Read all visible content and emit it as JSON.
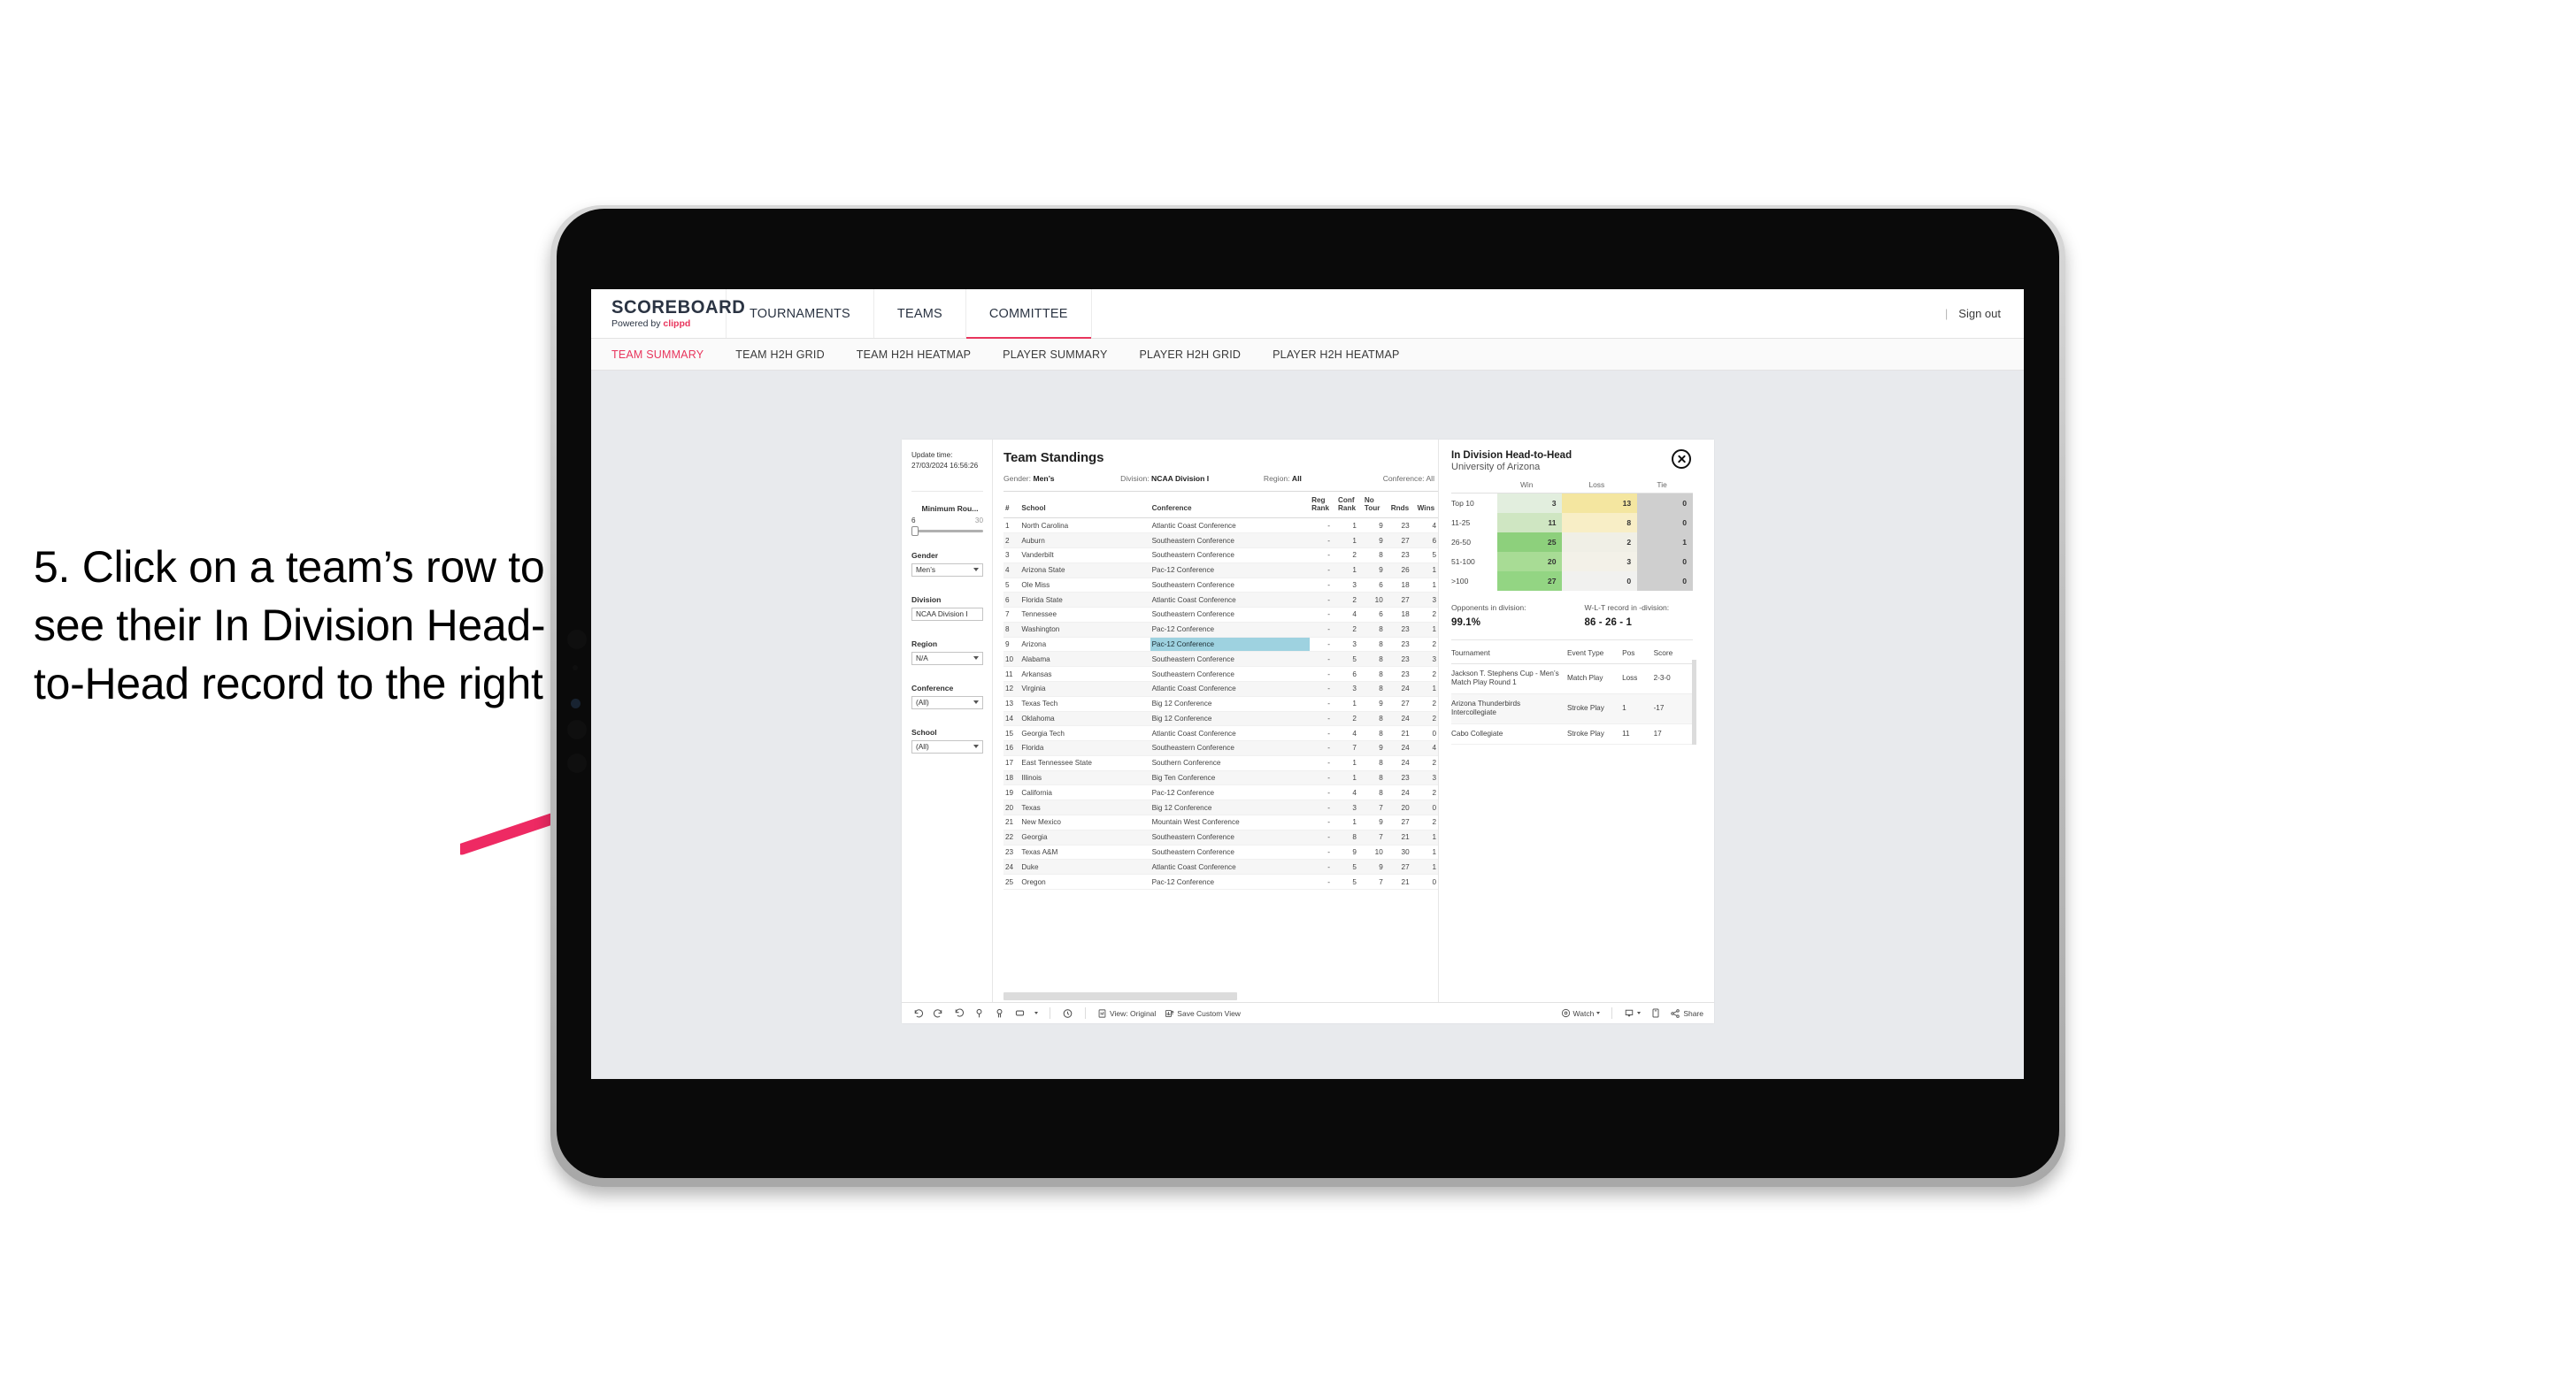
{
  "annotation": {
    "text": "5. Click on a team’s row to see their In Division Head-to-Head record to the right",
    "arrow_color": "#ee2a63"
  },
  "app": {
    "logo": {
      "main": "SCOREBOARD",
      "powered_prefix": "Powered by ",
      "powered_brand": "clippd"
    },
    "topnav": [
      {
        "label": "TOURNAMENTS",
        "active": false
      },
      {
        "label": "TEAMS",
        "active": false
      },
      {
        "label": "COMMITTEE",
        "active": true
      }
    ],
    "header_right": {
      "divider": "|",
      "sign_out": "Sign out"
    },
    "subnav": [
      {
        "label": "TEAM SUMMARY",
        "active": true
      },
      {
        "label": "TEAM H2H GRID",
        "active": false
      },
      {
        "label": "TEAM H2H HEATMAP",
        "active": false
      },
      {
        "label": "PLAYER SUMMARY",
        "active": false
      },
      {
        "label": "PLAYER H2H GRID",
        "active": false
      },
      {
        "label": "PLAYER H2H HEATMAP",
        "active": false
      }
    ]
  },
  "filters": {
    "update_time_label": "Update time:",
    "update_time_value": "27/03/2024 16:56:26",
    "min_rounds": {
      "title": "Minimum Rou...",
      "min": "6",
      "max": "30",
      "value": 6
    },
    "gender": {
      "title": "Gender",
      "value": "Men’s"
    },
    "division": {
      "title": "Division",
      "value": "NCAA Division I"
    },
    "region": {
      "title": "Region",
      "value": "N/A"
    },
    "conference": {
      "title": "Conference",
      "value": "(All)"
    },
    "school": {
      "title": "School",
      "value": "(All)"
    }
  },
  "standings": {
    "title": "Team Standings",
    "meta": {
      "gender_label": "Gender:",
      "gender_value": "Men’s",
      "division_label": "Division:",
      "division_value": "NCAA Division I",
      "region_label": "Region:",
      "region_value": "All",
      "conference_label": "Conference:",
      "conference_value": "All"
    },
    "columns": [
      "#",
      "School",
      "Conference",
      "Reg Rank",
      "Conf Rank",
      "No Tour",
      "Rnds",
      "Wins"
    ],
    "column_lines": [
      [
        "#",
        ""
      ],
      [
        "School",
        ""
      ],
      [
        "Conference",
        ""
      ],
      [
        "Reg",
        "Rank"
      ],
      [
        "Conf",
        "Rank"
      ],
      [
        "No",
        "Tour"
      ],
      [
        "Rnds",
        ""
      ],
      [
        "Wins",
        ""
      ]
    ],
    "selected_rank": 9,
    "rows": [
      {
        "rank": "1",
        "school": "North Carolina",
        "conference": "Atlantic Coast Conference",
        "reg_rank": "-",
        "conf_rank": "1",
        "no_tour": "9",
        "rnds": "23",
        "wins": "4"
      },
      {
        "rank": "2",
        "school": "Auburn",
        "conference": "Southeastern Conference",
        "reg_rank": "-",
        "conf_rank": "1",
        "no_tour": "9",
        "rnds": "27",
        "wins": "6"
      },
      {
        "rank": "3",
        "school": "Vanderbilt",
        "conference": "Southeastern Conference",
        "reg_rank": "-",
        "conf_rank": "2",
        "no_tour": "8",
        "rnds": "23",
        "wins": "5"
      },
      {
        "rank": "4",
        "school": "Arizona State",
        "conference": "Pac-12 Conference",
        "reg_rank": "-",
        "conf_rank": "1",
        "no_tour": "9",
        "rnds": "26",
        "wins": "1"
      },
      {
        "rank": "5",
        "school": "Ole Miss",
        "conference": "Southeastern Conference",
        "reg_rank": "-",
        "conf_rank": "3",
        "no_tour": "6",
        "rnds": "18",
        "wins": "1"
      },
      {
        "rank": "6",
        "school": "Florida State",
        "conference": "Atlantic Coast Conference",
        "reg_rank": "-",
        "conf_rank": "2",
        "no_tour": "10",
        "rnds": "27",
        "wins": "3"
      },
      {
        "rank": "7",
        "school": "Tennessee",
        "conference": "Southeastern Conference",
        "reg_rank": "-",
        "conf_rank": "4",
        "no_tour": "6",
        "rnds": "18",
        "wins": "2"
      },
      {
        "rank": "8",
        "school": "Washington",
        "conference": "Pac-12 Conference",
        "reg_rank": "-",
        "conf_rank": "2",
        "no_tour": "8",
        "rnds": "23",
        "wins": "1"
      },
      {
        "rank": "9",
        "school": "Arizona",
        "conference": "Pac-12 Conference",
        "reg_rank": "-",
        "conf_rank": "3",
        "no_tour": "8",
        "rnds": "23",
        "wins": "2"
      },
      {
        "rank": "10",
        "school": "Alabama",
        "conference": "Southeastern Conference",
        "reg_rank": "-",
        "conf_rank": "5",
        "no_tour": "8",
        "rnds": "23",
        "wins": "3"
      },
      {
        "rank": "11",
        "school": "Arkansas",
        "conference": "Southeastern Conference",
        "reg_rank": "-",
        "conf_rank": "6",
        "no_tour": "8",
        "rnds": "23",
        "wins": "2"
      },
      {
        "rank": "12",
        "school": "Virginia",
        "conference": "Atlantic Coast Conference",
        "reg_rank": "-",
        "conf_rank": "3",
        "no_tour": "8",
        "rnds": "24",
        "wins": "1"
      },
      {
        "rank": "13",
        "school": "Texas Tech",
        "conference": "Big 12 Conference",
        "reg_rank": "-",
        "conf_rank": "1",
        "no_tour": "9",
        "rnds": "27",
        "wins": "2"
      },
      {
        "rank": "14",
        "school": "Oklahoma",
        "conference": "Big 12 Conference",
        "reg_rank": "-",
        "conf_rank": "2",
        "no_tour": "8",
        "rnds": "24",
        "wins": "2"
      },
      {
        "rank": "15",
        "school": "Georgia Tech",
        "conference": "Atlantic Coast Conference",
        "reg_rank": "-",
        "conf_rank": "4",
        "no_tour": "8",
        "rnds": "21",
        "wins": "0"
      },
      {
        "rank": "16",
        "school": "Florida",
        "conference": "Southeastern Conference",
        "reg_rank": "-",
        "conf_rank": "7",
        "no_tour": "9",
        "rnds": "24",
        "wins": "4"
      },
      {
        "rank": "17",
        "school": "East Tennessee State",
        "conference": "Southern Conference",
        "reg_rank": "-",
        "conf_rank": "1",
        "no_tour": "8",
        "rnds": "24",
        "wins": "2"
      },
      {
        "rank": "18",
        "school": "Illinois",
        "conference": "Big Ten Conference",
        "reg_rank": "-",
        "conf_rank": "1",
        "no_tour": "8",
        "rnds": "23",
        "wins": "3"
      },
      {
        "rank": "19",
        "school": "California",
        "conference": "Pac-12 Conference",
        "reg_rank": "-",
        "conf_rank": "4",
        "no_tour": "8",
        "rnds": "24",
        "wins": "2"
      },
      {
        "rank": "20",
        "school": "Texas",
        "conference": "Big 12 Conference",
        "reg_rank": "-",
        "conf_rank": "3",
        "no_tour": "7",
        "rnds": "20",
        "wins": "0"
      },
      {
        "rank": "21",
        "school": "New Mexico",
        "conference": "Mountain West Conference",
        "reg_rank": "-",
        "conf_rank": "1",
        "no_tour": "9",
        "rnds": "27",
        "wins": "2"
      },
      {
        "rank": "22",
        "school": "Georgia",
        "conference": "Southeastern Conference",
        "reg_rank": "-",
        "conf_rank": "8",
        "no_tour": "7",
        "rnds": "21",
        "wins": "1"
      },
      {
        "rank": "23",
        "school": "Texas A&M",
        "conference": "Southeastern Conference",
        "reg_rank": "-",
        "conf_rank": "9",
        "no_tour": "10",
        "rnds": "30",
        "wins": "1"
      },
      {
        "rank": "24",
        "school": "Duke",
        "conference": "Atlantic Coast Conference",
        "reg_rank": "-",
        "conf_rank": "5",
        "no_tour": "9",
        "rnds": "27",
        "wins": "1"
      },
      {
        "rank": "25",
        "school": "Oregon",
        "conference": "Pac-12 Conference",
        "reg_rank": "-",
        "conf_rank": "5",
        "no_tour": "7",
        "rnds": "21",
        "wins": "0"
      }
    ]
  },
  "detail": {
    "title": "In Division Head-to-Head",
    "subtitle": "University of Arizona",
    "close_icon": "close-icon",
    "chart_data": {
      "type": "heatmap",
      "title": "In Division Head-to-Head",
      "subtitle": "University of Arizona",
      "xlabel": "",
      "ylabel": "",
      "columns": [
        "Win",
        "Loss",
        "Tie"
      ],
      "rows": [
        "Top 10",
        "11-25",
        "26-50",
        "51-100",
        ">100"
      ],
      "values": [
        [
          3,
          13,
          0
        ],
        [
          11,
          8,
          0
        ],
        [
          25,
          2,
          1
        ],
        [
          20,
          3,
          0
        ],
        [
          27,
          0,
          0
        ]
      ],
      "cell_colors": [
        [
          "#e2eede",
          "#f4e6a0",
          "#cfcfcf"
        ],
        [
          "#cfe6c2",
          "#f8eec6",
          "#cfcfcf"
        ],
        [
          "#8dd07c",
          "#f0efe6",
          "#cfcfcf"
        ],
        [
          "#a8dc95",
          "#f3f1e8",
          "#cfcfcf"
        ],
        [
          "#93d583",
          "#f1f1ef",
          "#cfcfcf"
        ]
      ],
      "legend": "none"
    },
    "stats": {
      "opponents_label": "Opponents in division:",
      "opponents_value": "99.1%",
      "record_label": "W-L-T record in -division:",
      "record_value": "86 - 26 - 1"
    },
    "tournaments": {
      "columns": [
        "Tournament",
        "Event Type",
        "Pos",
        "Score"
      ],
      "rows": [
        {
          "tournament": "Jackson T. Stephens Cup - Men’s Match Play Round 1",
          "event_type": "Match Play",
          "pos": "Loss",
          "score": "2-3-0"
        },
        {
          "tournament": "Arizona Thunderbirds Intercollegiate",
          "event_type": "Stroke Play",
          "pos": "1",
          "score": "-17"
        },
        {
          "tournament": "Cabo Collegiate",
          "event_type": "Stroke Play",
          "pos": "11",
          "score": "17"
        }
      ]
    }
  },
  "toolbar": {
    "icons": [
      "undo-icon",
      "redo-icon",
      "revert-icon",
      "refresh-icon",
      "pause-icon",
      "rectangle-select-icon",
      "chevron-down-icon",
      "clock-history-icon"
    ],
    "view_label": "View: Original",
    "save_custom_view_label": "Save Custom View",
    "watch_label": "Watch",
    "share_label": "Share"
  }
}
